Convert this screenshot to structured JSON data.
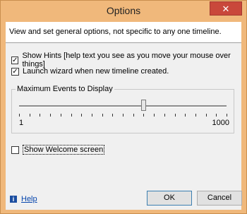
{
  "window": {
    "title": "Options",
    "close_glyph": "✕"
  },
  "header": {
    "description": "View and set general options, not specific to any one timeline."
  },
  "options": {
    "show_hints": {
      "label": "Show Hints  [help text you see as you move your mouse over things]",
      "checked": true
    },
    "launch_wizard": {
      "label": "Launch wizard when new timeline created.",
      "checked": true
    },
    "show_welcome": {
      "label": "Show Welcome screen",
      "checked": false
    }
  },
  "max_events": {
    "group_label": "Maximum Events to Display",
    "min_label": "1",
    "max_label": "1000",
    "value_fraction": 0.6
  },
  "footer": {
    "help_label": "Help",
    "ok_label": "OK",
    "cancel_label": "Cancel"
  },
  "icons": {
    "help_icon": "info-book-icon",
    "close_icon": "close-icon"
  }
}
